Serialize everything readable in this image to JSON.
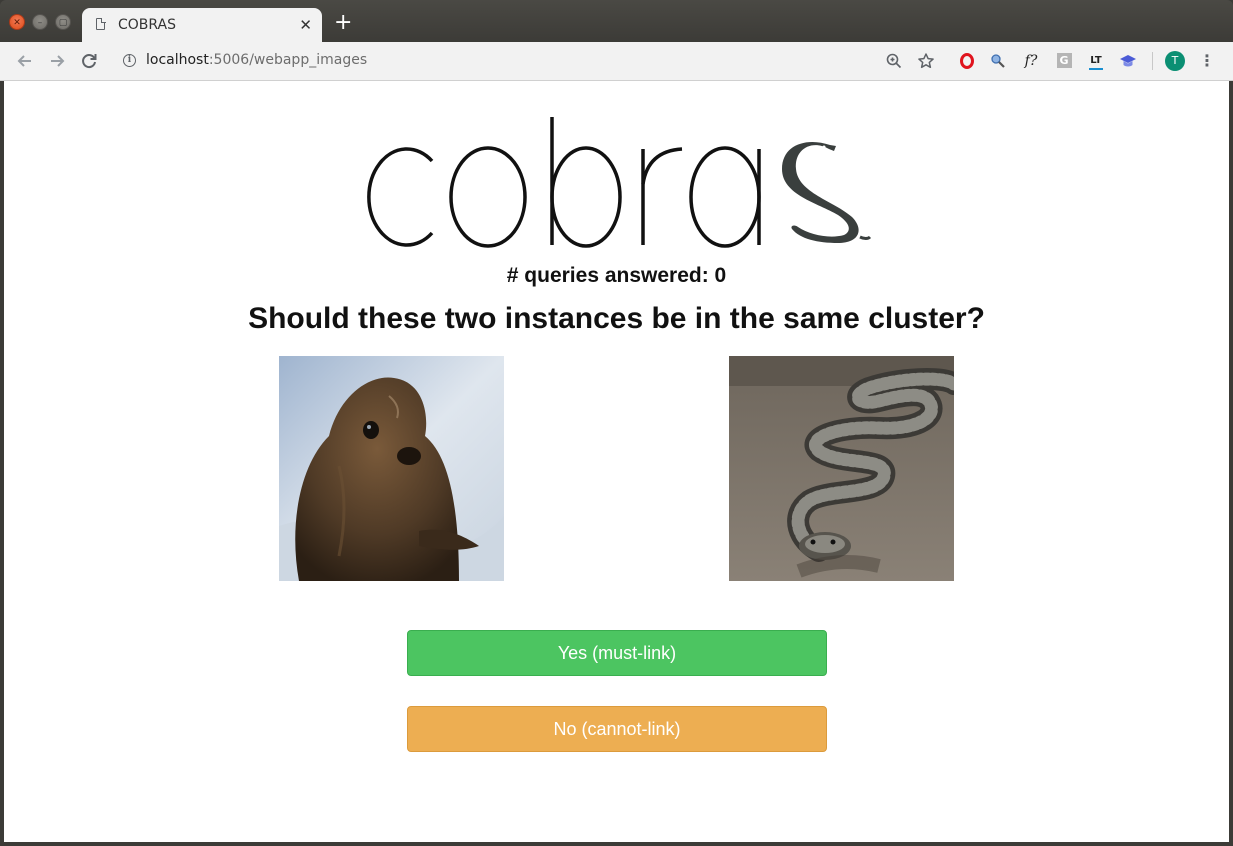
{
  "browser": {
    "tab_title": "COBRAS",
    "tab_close_glyph": "✕",
    "new_tab_glyph": "+",
    "url_host": "localhost",
    "url_path": ":5006/webapp_images",
    "extensions": [
      "opera-icon",
      "search-extension-icon",
      "f-question-icon",
      "g-extension-icon",
      "languagetool-icon",
      "graduation-cap-icon"
    ],
    "profile_initial": "T"
  },
  "app": {
    "logo_text": "cobras",
    "queries_label": "# queries answered: 0",
    "question": "Should these two instances be in the same cluster?",
    "instances": [
      {
        "name": "sea-lion-image",
        "subject": "sea lion pup on sand"
      },
      {
        "name": "snake-image",
        "subject": "snake on asphalt"
      }
    ],
    "buttons": {
      "yes_label": "Yes (must-link)",
      "no_label": "No (cannot-link)"
    },
    "colors": {
      "yes": "#4cc561",
      "no": "#edae52"
    }
  }
}
